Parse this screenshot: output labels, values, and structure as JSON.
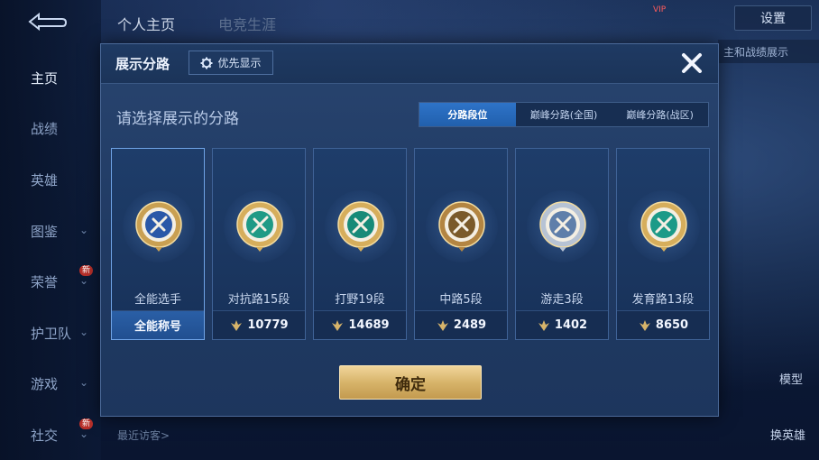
{
  "background": {
    "top_tabs": [
      "个人主页",
      "电竞生涯"
    ],
    "settings_label": "设置",
    "vip_label": "VIP",
    "note_text": "主和战绩展示",
    "model_label": "模型",
    "swap_hero_label": "换英雄",
    "visitors_label": "最近访客>"
  },
  "sidebar": {
    "items": [
      {
        "label": "主页",
        "active": true,
        "chevron": false,
        "new": false
      },
      {
        "label": "战绩",
        "active": false,
        "chevron": false,
        "new": false
      },
      {
        "label": "英雄",
        "active": false,
        "chevron": false,
        "new": false
      },
      {
        "label": "图鉴",
        "active": false,
        "chevron": true,
        "new": false
      },
      {
        "label": "荣誉",
        "active": false,
        "chevron": true,
        "new": true
      },
      {
        "label": "护卫队",
        "active": false,
        "chevron": true,
        "new": false
      },
      {
        "label": "游戏",
        "active": false,
        "chevron": true,
        "new": false
      },
      {
        "label": "社交",
        "active": false,
        "chevron": true,
        "new": true
      }
    ],
    "new_tag": "新"
  },
  "dialog": {
    "title": "展示分路",
    "priority_label": "优先显示",
    "prompt": "请选择展示的分路",
    "tabs": [
      {
        "label": "分路段位",
        "active": true
      },
      {
        "label": "巅峰分路(全国)",
        "active": false
      },
      {
        "label": "巅峰分路(战区)",
        "active": false
      }
    ],
    "cards": [
      {
        "name": "全能选手",
        "footer": "全能称号",
        "has_score": false,
        "selected": true,
        "emblem": "all-round-emblem-icon",
        "rim": "#c9a052",
        "core": "#2a58a8"
      },
      {
        "name": "对抗路15段",
        "footer": "10779",
        "has_score": true,
        "selected": false,
        "emblem": "clash-lane-emblem-icon",
        "rim": "#d6ae5c",
        "core": "#1f9a86"
      },
      {
        "name": "打野19段",
        "footer": "14689",
        "has_score": true,
        "selected": false,
        "emblem": "jungle-emblem-icon",
        "rim": "#d6ae5c",
        "core": "#178a78"
      },
      {
        "name": "中路5段",
        "footer": "2489",
        "has_score": true,
        "selected": false,
        "emblem": "mid-lane-emblem-icon",
        "rim": "#b38542",
        "core": "#7a5a2a"
      },
      {
        "name": "游走3段",
        "footer": "1402",
        "has_score": true,
        "selected": false,
        "emblem": "roam-emblem-icon",
        "rim": "#b7c3d4",
        "core": "#5f7faa"
      },
      {
        "name": "发育路13段",
        "footer": "8650",
        "has_score": true,
        "selected": false,
        "emblem": "farm-lane-emblem-icon",
        "rim": "#d6ae5c",
        "core": "#1c9a88"
      }
    ],
    "confirm_label": "确定"
  },
  "colors": {
    "accent_blue": "#2e73c8",
    "gold": "#d7b46a",
    "dialog_bg": "#28446f"
  }
}
